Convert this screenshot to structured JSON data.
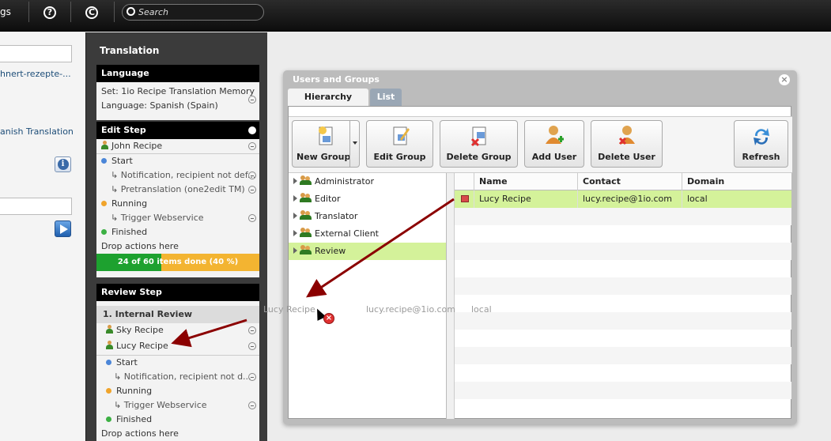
{
  "topbar": {
    "settings_label": "gs",
    "help_icon": "question-circle-icon",
    "copyright_icon": "copyright-circle-icon",
    "search_placeholder": "Search"
  },
  "left": {
    "link1": "hnert-rezepte-...",
    "link2": "anish Translation"
  },
  "translation": {
    "title": "Translation",
    "language": {
      "header": "Language",
      "set": "Set: 1io Recipe Translation Memory",
      "lang": "Language: Spanish (Spain)"
    },
    "edit_step": {
      "header": "Edit Step",
      "assignee": "John Recipe",
      "start": "Start",
      "start_a1": "Notification, recipient not def...",
      "start_a2": "Pretranslation (one2edit TM)",
      "running": "Running",
      "running_a1": "Trigger Webservice",
      "finished": "Finished",
      "drop": "Drop actions here",
      "progress_text": "24 of 60 items done (40 %)",
      "progress_fraction": 0.4
    },
    "review_step": {
      "header": "Review Step",
      "sub": "1. Internal Review",
      "user1": "Sky Recipe",
      "user2": "Lucy Recipe",
      "start": "Start",
      "start_a1": "Notification, recipient not d...",
      "running": "Running",
      "running_a1": "Trigger Webservice",
      "finished": "Finished",
      "drop": "Drop actions here"
    }
  },
  "dialog": {
    "title": "Users and Groups",
    "tabs": [
      "Hierarchy",
      "List"
    ],
    "toolbar": {
      "new_group": "New Group",
      "edit_group": "Edit Group",
      "delete_group": "Delete Group",
      "add_user": "Add User",
      "delete_user": "Delete User",
      "refresh": "Refresh"
    },
    "tree": [
      "Administrator",
      "Editor",
      "Translator",
      "External Client",
      "Review"
    ],
    "columns": [
      "Name",
      "Contact",
      "Domain"
    ],
    "rows": [
      {
        "name": "Lucy Recipe",
        "contact": "lucy.recipe@1io.com",
        "domain": "local"
      }
    ]
  },
  "drag_ghost": {
    "name": "Lucy Recipe",
    "contact": "lucy.recipe@1io.com",
    "domain": "local"
  },
  "colors": {
    "selection": "#d4f29a",
    "progress_done": "#1da12f",
    "progress_rest": "#f3b431",
    "arrow": "#8b0000"
  }
}
